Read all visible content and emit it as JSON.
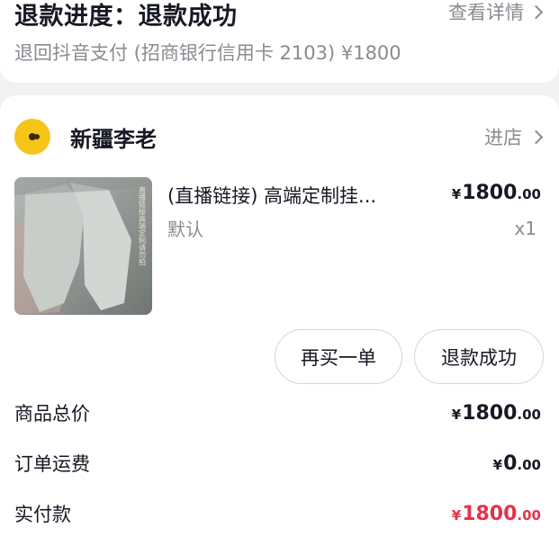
{
  "refund": {
    "title": "退款进度：退款成功",
    "view_detail": "查看详情",
    "subtitle": "退回抖音支付 (招商银行信用卡 2103) ¥1800"
  },
  "shop": {
    "name": "新疆李老",
    "enter_label": "进店"
  },
  "product": {
    "name": "(直播链接) 高端定制挂...",
    "spec": "默认",
    "price_currency": "¥",
    "price_int": "1800",
    "price_dec": ".00",
    "quantity": "x1",
    "image_overlay_text": "直播链接高端定制请勿拍"
  },
  "actions": {
    "rebuy": "再买一单",
    "refund_success": "退款成功"
  },
  "summary": {
    "total_label": "商品总价",
    "total_cur": "¥",
    "total_int": "1800",
    "total_dec": ".00",
    "shipping_label": "订单运费",
    "shipping_cur": "¥",
    "shipping_int": "0",
    "shipping_dec": ".00",
    "paid_label": "实付款",
    "paid_cur": "¥",
    "paid_int": "1800",
    "paid_dec": ".00"
  },
  "colors": {
    "accent_red": "#e5334a",
    "shop_logo": "#f5c518",
    "muted_text": "#8a8b91"
  }
}
